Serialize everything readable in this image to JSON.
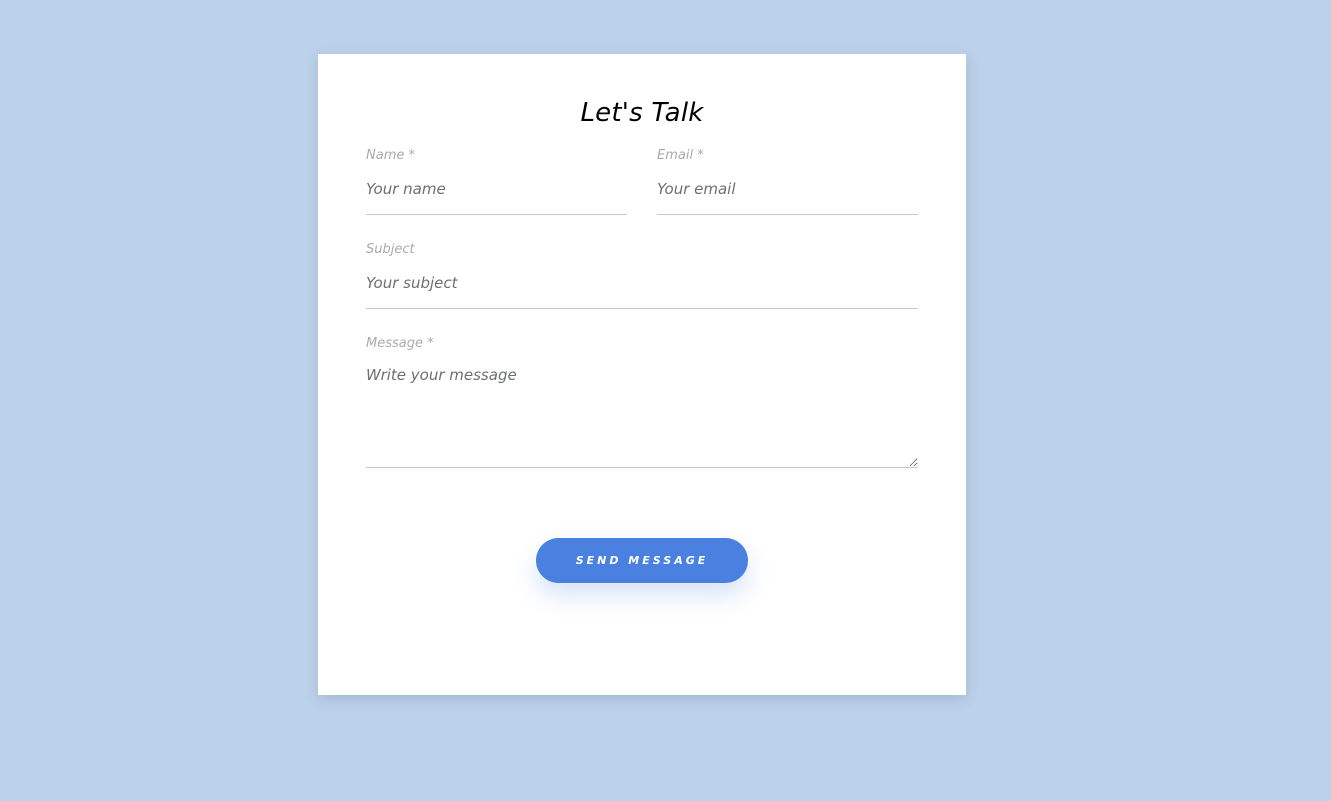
{
  "form": {
    "title": "Let's Talk",
    "name": {
      "label": "Name *",
      "placeholder": "Your name"
    },
    "email": {
      "label": "Email *",
      "placeholder": "Your email"
    },
    "subject": {
      "label": "Subject",
      "placeholder": "Your subject"
    },
    "message": {
      "label": "Message *",
      "placeholder": "Write your message"
    },
    "submit_label": "SEND MESSAGE"
  },
  "colors": {
    "background": "#bcd1ea",
    "card": "#ffffff",
    "accent": "#4a80e0",
    "label": "#a9aaad",
    "placeholder": "#6c6f74"
  }
}
